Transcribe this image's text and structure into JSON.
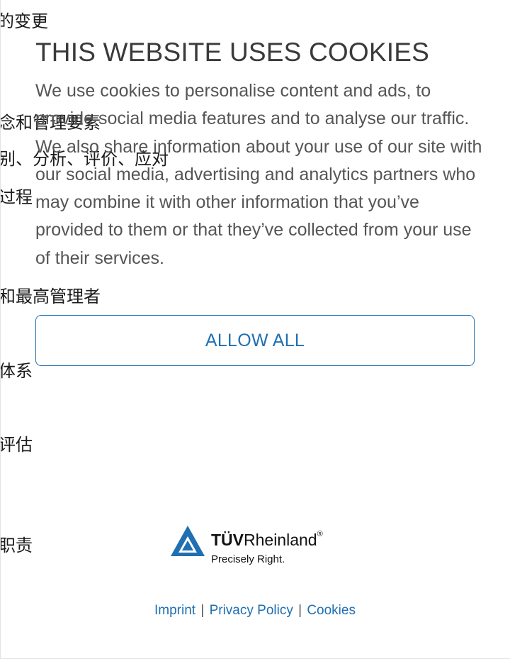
{
  "background_page": {
    "lines": [
      "的变更",
      "念和管理要素",
      "别、分析、评价、应对",
      "过程",
      "和最高管理者",
      "体系",
      "评估",
      "职责"
    ]
  },
  "cookie_banner": {
    "title": "THIS WEBSITE USES COOKIES",
    "body": "We use cookies to personalise content and ads, to provide social media features and to analyse our traffic. We also share information about your use of our site with our social media, advertising and analytics partners who may combine it with other information that you’ve provided to them or that they’ve collected from your use of their services.",
    "allow_all_label": "ALLOW ALL"
  },
  "footer": {
    "logo": {
      "icon": "tuv-triangle-logo-icon",
      "brand_bold": "TÜV",
      "brand_regular": "Rheinland",
      "registered_mark": "®",
      "tagline": "Precisely Right."
    },
    "links": {
      "imprint": "Imprint",
      "privacy": "Privacy Policy",
      "cookies": "Cookies",
      "separator": "|"
    }
  },
  "colors": {
    "accent": "#1f6fb2",
    "title": "#3a3a3a",
    "body": "#555555"
  }
}
